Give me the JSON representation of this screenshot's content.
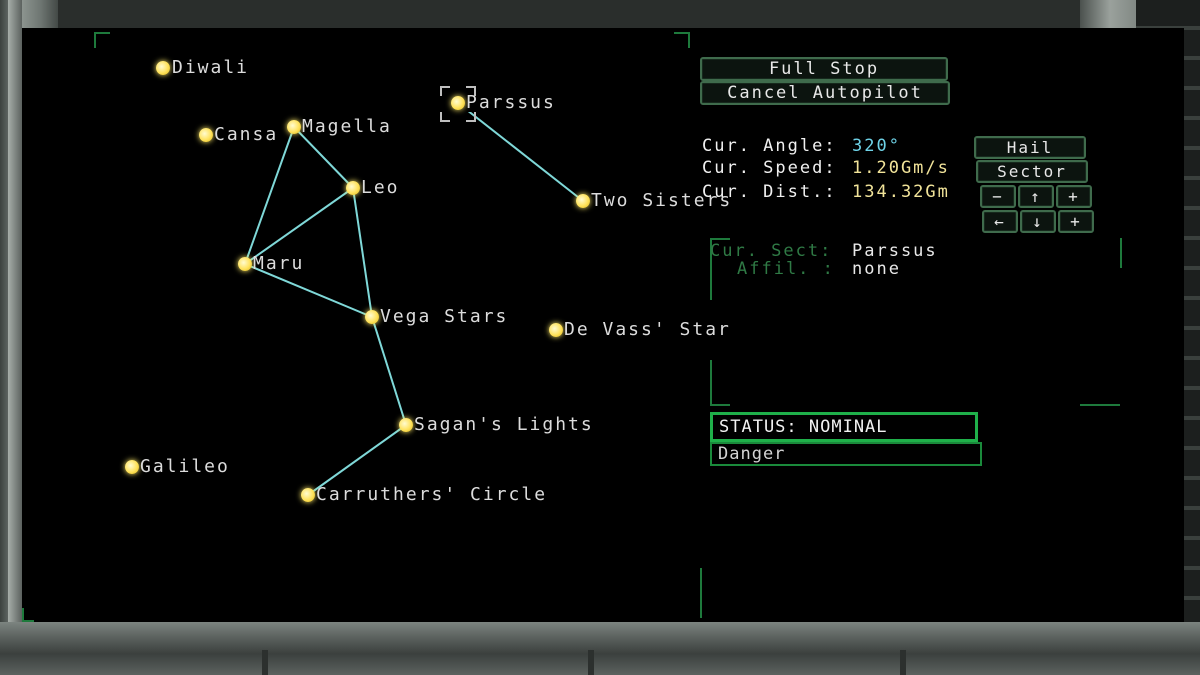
{
  "map": {
    "stars": [
      {
        "name": "Diwali"
      },
      {
        "name": "Cansa"
      },
      {
        "name": "Magella"
      },
      {
        "name": "Parssus"
      },
      {
        "name": "Leo"
      },
      {
        "name": "Two Sisters"
      },
      {
        "name": "Maru"
      },
      {
        "name": "Vega Stars"
      },
      {
        "name": "De Vass' Star"
      },
      {
        "name": "Sagan's Lights"
      },
      {
        "name": "Galileo"
      },
      {
        "name": "Carruthers' Circle"
      }
    ],
    "selected": "Parssus",
    "colors": {
      "star": "#ffe25a",
      "route": "#7fd8d8",
      "bracket": "#1e7a3c"
    }
  },
  "controls": {
    "full_stop": "Full Stop",
    "cancel_autopilot": "Cancel Autopilot",
    "hail": "Hail",
    "sector": "Sector",
    "minus": "−",
    "up": "↑",
    "plus": "+",
    "left": "←",
    "down": "↓",
    "right": "+"
  },
  "nav": {
    "angle_label": "Cur. Angle:",
    "angle_value": "320°",
    "speed_label": "Cur. Speed:",
    "speed_value": "1.20Gm/s",
    "dist_label": "Cur. Dist.:",
    "dist_value": "134.32Gm"
  },
  "sector": {
    "sect_label": "Cur. Sect:",
    "sect_value": "Parssus",
    "affil_label": "Affil. :",
    "affil_value": "none"
  },
  "status": {
    "status_text": "STATUS: NOMINAL",
    "danger_text": "Danger",
    "color": "#1fb04a"
  }
}
